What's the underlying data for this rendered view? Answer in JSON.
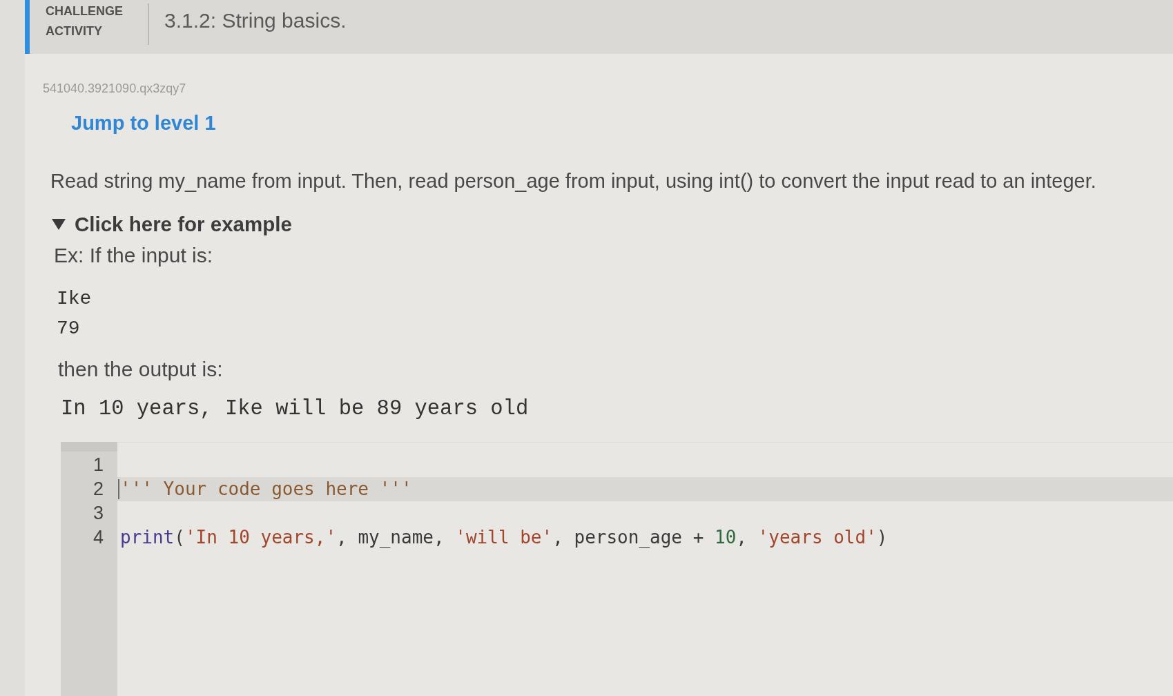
{
  "header": {
    "category": "CHALLENGE ACTIVITY",
    "title": "3.1.2: String basics."
  },
  "activity_id": "541040.3921090.qx3zqy7",
  "level_link": "Jump to level 1",
  "instructions": "Read string my_name from input. Then, read person_age from input, using int() to convert the input read to an integer.",
  "example": {
    "toggle": "Click here for example",
    "expanded": true,
    "input_intro": "Ex: If the input is:",
    "input_lines": [
      "Ike",
      "79"
    ],
    "output_intro": "then the output is:",
    "output_lines": [
      "In 10 years, Ike will be 89 years old"
    ]
  },
  "editor": {
    "lines": [
      {
        "number": "1",
        "active": false
      },
      {
        "number": "2",
        "active": true,
        "tokens": [
          {
            "kind": "comment",
            "text": "''' Your code goes here '''"
          }
        ]
      },
      {
        "number": "3",
        "active": false
      },
      {
        "number": "4",
        "active": false,
        "tokens": [
          {
            "kind": "builtin",
            "text": "print"
          },
          {
            "kind": "plain",
            "text": "("
          },
          {
            "kind": "string",
            "text": "'In 10 years,'"
          },
          {
            "kind": "plain",
            "text": ", my_name, "
          },
          {
            "kind": "string",
            "text": "'will be'"
          },
          {
            "kind": "plain",
            "text": ", person_age + "
          },
          {
            "kind": "number",
            "text": "10"
          },
          {
            "kind": "plain",
            "text": ", "
          },
          {
            "kind": "string",
            "text": "'years old'"
          },
          {
            "kind": "plain",
            "text": ")"
          }
        ]
      }
    ]
  }
}
